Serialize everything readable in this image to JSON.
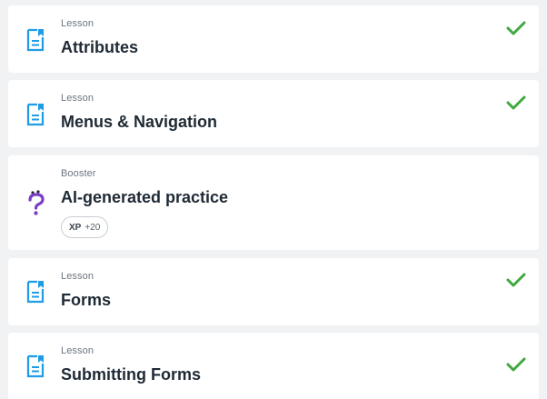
{
  "colors": {
    "lesson_icon": "#1e9de6",
    "check": "#3fa83f",
    "booster_icon": "#7b3fc6"
  },
  "items": [
    {
      "kind": "Lesson",
      "title": "Attributes",
      "icon": "lesson-doc-icon",
      "completed": true
    },
    {
      "kind": "Lesson",
      "title": "Menus & Navigation",
      "icon": "lesson-doc-icon",
      "completed": true
    },
    {
      "kind": "Booster",
      "title": "AI-generated practice",
      "icon": "question-mark-icon",
      "completed": false,
      "badge": {
        "label": "XP",
        "value": "+20"
      }
    },
    {
      "kind": "Lesson",
      "title": "Forms",
      "icon": "lesson-doc-icon",
      "completed": true
    },
    {
      "kind": "Lesson",
      "title": "Submitting Forms",
      "icon": "lesson-doc-icon",
      "completed": true
    }
  ]
}
